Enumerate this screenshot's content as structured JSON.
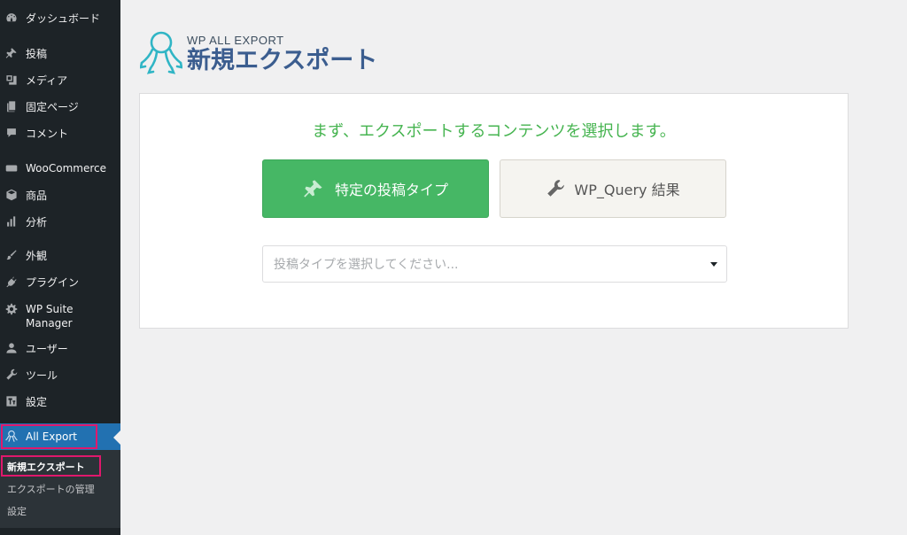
{
  "sidebar": {
    "items": [
      {
        "label": "ダッシュボード",
        "icon": "dashboard-icon"
      },
      {
        "label": "投稿",
        "icon": "pin-icon"
      },
      {
        "label": "メディア",
        "icon": "media-icon"
      },
      {
        "label": "固定ページ",
        "icon": "page-icon"
      },
      {
        "label": "コメント",
        "icon": "comment-icon"
      },
      {
        "label": "WooCommerce",
        "icon": "woo-icon"
      },
      {
        "label": "商品",
        "icon": "box-icon"
      },
      {
        "label": "分析",
        "icon": "bar-chart-icon"
      },
      {
        "label": "外観",
        "icon": "brush-icon"
      },
      {
        "label": "プラグイン",
        "icon": "plug-icon"
      },
      {
        "label": "WP Suite Manager",
        "line1": "WP Suite",
        "line2": "Manager",
        "icon": "gear-icon"
      },
      {
        "label": "ユーザー",
        "icon": "user-icon"
      },
      {
        "label": "ツール",
        "icon": "wrench-icon"
      },
      {
        "label": "設定",
        "icon": "settings-icon"
      }
    ],
    "active": {
      "label": "All Export",
      "icon": "octopus-icon"
    },
    "submenu": [
      {
        "label": "新規エクスポート",
        "current": true
      },
      {
        "label": "エクスポートの管理",
        "current": false
      },
      {
        "label": "設定",
        "current": false
      }
    ]
  },
  "header": {
    "sub_title": "WP ALL EXPORT",
    "title": "新規エクスポート"
  },
  "panel": {
    "prompt": "まず、エクスポートするコンテンツを選択します。",
    "post_type_button": "特定の投稿タイプ",
    "wp_query_button": "WP_Query 結果",
    "select_placeholder": "投稿タイプを選択してください..."
  },
  "colors": {
    "sidebar_bg": "#1d2327",
    "active_bg": "#2271b1",
    "highlight": "#e0186c",
    "green": "#46b765",
    "prompt_green": "#46b450",
    "brand_blue": "#3b5d8f",
    "logo_teal": "#30b5c5"
  }
}
